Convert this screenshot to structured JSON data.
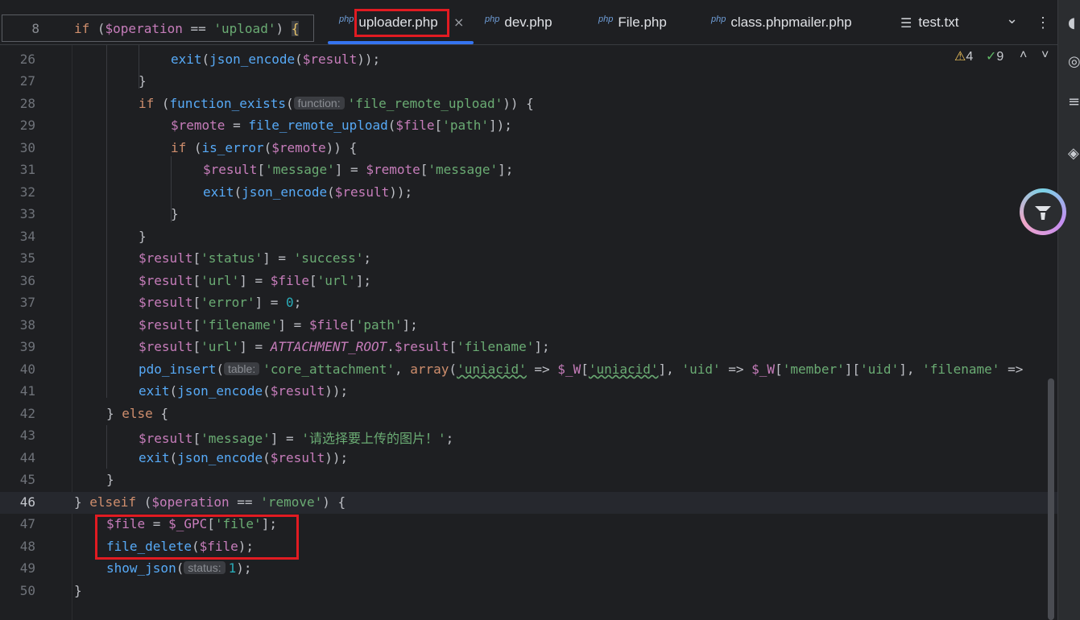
{
  "sticky": {
    "line_num": "8",
    "kw": "if",
    "open": " (",
    "var": "$operation",
    "op": " == ",
    "str": "'upload'",
    "close": ") ",
    "brace": "{"
  },
  "tabs": [
    {
      "type": "php",
      "name": "uploader.php"
    },
    {
      "type": "php",
      "name": "dev.php"
    },
    {
      "type": "php",
      "name": "File.php"
    },
    {
      "type": "php",
      "name": "class.phpmailer.php"
    },
    {
      "type": "",
      "name": "test.txt"
    }
  ],
  "toolbar": {
    "chevron": "⌄",
    "more": "⋮",
    "close": "×"
  },
  "inspections": {
    "warnings": "4",
    "weak_warnings": "9"
  },
  "lines": {
    "l26": {
      "n": "26",
      "fn": "exit",
      "a": "(",
      "fn2": "json_encode",
      "b": "(",
      "v": "$result",
      "c": "));"
    },
    "l27": {
      "n": "27",
      "t": "}"
    },
    "l28": {
      "n": "28",
      "kw": "if",
      "a": " (",
      "fn": "function_exists",
      "b": "(",
      "hint": "function:",
      "s": "'file_remote_upload'",
      "c": ")) {"
    },
    "l29": {
      "n": "29",
      "v": "$remote",
      "a": " = ",
      "fn": "file_remote_upload",
      "b": "(",
      "v2": "$file",
      "c": "[",
      "s": "'path'",
      "d": "]);"
    },
    "l30": {
      "n": "30",
      "kw": "if",
      "a": " (",
      "fn": "is_error",
      "b": "(",
      "v": "$remote",
      "c": ")) {"
    },
    "l31": {
      "n": "31",
      "v": "$result",
      "a": "[",
      "s": "'message'",
      "b": "] = ",
      "v2": "$remote",
      "c": "[",
      "s2": "'message'",
      "d": "];"
    },
    "l32": {
      "n": "32",
      "fn": "exit",
      "a": "(",
      "fn2": "json_encode",
      "b": "(",
      "v": "$result",
      "c": "));"
    },
    "l33": {
      "n": "33",
      "t": "}"
    },
    "l34": {
      "n": "34",
      "t": "}"
    },
    "l35": {
      "n": "35",
      "v": "$result",
      "a": "[",
      "s": "'status'",
      "b": "] = ",
      "s2": "'success'",
      "c": ";"
    },
    "l36": {
      "n": "36",
      "v": "$result",
      "a": "[",
      "s": "'url'",
      "b": "] = ",
      "v2": "$file",
      "c": "[",
      "s2": "'url'",
      "d": "];"
    },
    "l37": {
      "n": "37",
      "v": "$result",
      "a": "[",
      "s": "'error'",
      "b": "] = ",
      "num": "0",
      "c": ";"
    },
    "l38": {
      "n": "38",
      "v": "$result",
      "a": "[",
      "s": "'filename'",
      "b": "] = ",
      "v2": "$file",
      "c": "[",
      "s2": "'path'",
      "d": "];"
    },
    "l39": {
      "n": "39",
      "v": "$result",
      "a": "[",
      "s": "'url'",
      "b": "] = ",
      "k": "ATTACHMENT_ROOT",
      "c": ".",
      "v2": "$result",
      "d": "[",
      "s2": "'filename'",
      "e": "];"
    },
    "l40": {
      "n": "40",
      "fn": "pdo_insert",
      "a": "(",
      "hint": "table:",
      "s": "'core_attachment'",
      "b": ", ",
      "fn2": "array",
      "c": "(",
      "s2": "'uniacid'",
      "d": " => ",
      "v": "$_W",
      "e": "[",
      "s3": "'uniacid'",
      "f": "], ",
      "s4": "'uid'",
      "g": " => ",
      "v2": "$_W",
      "h": "[",
      "s5": "'member'",
      "i": "][",
      "s6": "'uid'",
      "j": "], ",
      "s7": "'filename'",
      "k": " =>"
    },
    "l41": {
      "n": "41",
      "fn": "exit",
      "a": "(",
      "fn2": "json_encode",
      "b": "(",
      "v": "$result",
      "c": "));"
    },
    "l42": {
      "n": "42",
      "a": "} ",
      "kw": "else",
      "b": " {"
    },
    "l43": {
      "n": "43",
      "v": "$result",
      "a": "[",
      "s": "'message'",
      "b": "] = ",
      "s2": "'请选择要上传的图片！'",
      "c": ";"
    },
    "l44": {
      "n": "44",
      "fn": "exit",
      "a": "(",
      "fn2": "json_encode",
      "b": "(",
      "v": "$result",
      "c": "));"
    },
    "l45": {
      "n": "45",
      "t": "}"
    },
    "l46": {
      "n": "46",
      "a": "} ",
      "kw": "elseif",
      "b": " (",
      "v": "$operation",
      "c": " == ",
      "s": "'remove'",
      "d": ") {"
    },
    "l47": {
      "n": "47",
      "v": "$file",
      "a": " = ",
      "v2": "$_GPC",
      "b": "[",
      "s": "'file'",
      "c": "];"
    },
    "l48": {
      "n": "48",
      "fn": "file_delete",
      "a": "(",
      "v": "$file",
      "b": ");"
    },
    "l49": {
      "n": "49",
      "fn": "show_json",
      "a": "(",
      "hint": "status:",
      "num": "1",
      "b": ");"
    },
    "l50": {
      "n": "50",
      "t": "}"
    }
  }
}
